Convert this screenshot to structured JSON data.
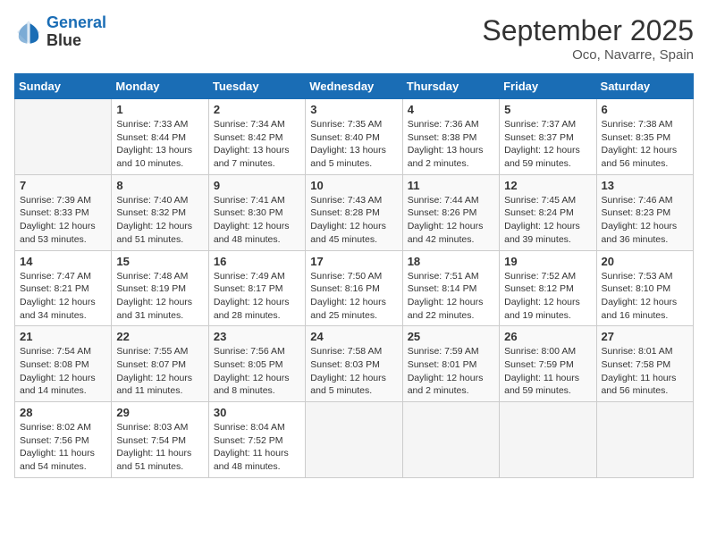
{
  "header": {
    "logo_line1": "General",
    "logo_line2": "Blue",
    "month": "September 2025",
    "location": "Oco, Navarre, Spain"
  },
  "days_of_week": [
    "Sunday",
    "Monday",
    "Tuesday",
    "Wednesday",
    "Thursday",
    "Friday",
    "Saturday"
  ],
  "weeks": [
    [
      {
        "day": "",
        "sunrise": "",
        "sunset": "",
        "daylight": ""
      },
      {
        "day": "1",
        "sunrise": "Sunrise: 7:33 AM",
        "sunset": "Sunset: 8:44 PM",
        "daylight": "Daylight: 13 hours and 10 minutes."
      },
      {
        "day": "2",
        "sunrise": "Sunrise: 7:34 AM",
        "sunset": "Sunset: 8:42 PM",
        "daylight": "Daylight: 13 hours and 7 minutes."
      },
      {
        "day": "3",
        "sunrise": "Sunrise: 7:35 AM",
        "sunset": "Sunset: 8:40 PM",
        "daylight": "Daylight: 13 hours and 5 minutes."
      },
      {
        "day": "4",
        "sunrise": "Sunrise: 7:36 AM",
        "sunset": "Sunset: 8:38 PM",
        "daylight": "Daylight: 13 hours and 2 minutes."
      },
      {
        "day": "5",
        "sunrise": "Sunrise: 7:37 AM",
        "sunset": "Sunset: 8:37 PM",
        "daylight": "Daylight: 12 hours and 59 minutes."
      },
      {
        "day": "6",
        "sunrise": "Sunrise: 7:38 AM",
        "sunset": "Sunset: 8:35 PM",
        "daylight": "Daylight: 12 hours and 56 minutes."
      }
    ],
    [
      {
        "day": "7",
        "sunrise": "Sunrise: 7:39 AM",
        "sunset": "Sunset: 8:33 PM",
        "daylight": "Daylight: 12 hours and 53 minutes."
      },
      {
        "day": "8",
        "sunrise": "Sunrise: 7:40 AM",
        "sunset": "Sunset: 8:32 PM",
        "daylight": "Daylight: 12 hours and 51 minutes."
      },
      {
        "day": "9",
        "sunrise": "Sunrise: 7:41 AM",
        "sunset": "Sunset: 8:30 PM",
        "daylight": "Daylight: 12 hours and 48 minutes."
      },
      {
        "day": "10",
        "sunrise": "Sunrise: 7:43 AM",
        "sunset": "Sunset: 8:28 PM",
        "daylight": "Daylight: 12 hours and 45 minutes."
      },
      {
        "day": "11",
        "sunrise": "Sunrise: 7:44 AM",
        "sunset": "Sunset: 8:26 PM",
        "daylight": "Daylight: 12 hours and 42 minutes."
      },
      {
        "day": "12",
        "sunrise": "Sunrise: 7:45 AM",
        "sunset": "Sunset: 8:24 PM",
        "daylight": "Daylight: 12 hours and 39 minutes."
      },
      {
        "day": "13",
        "sunrise": "Sunrise: 7:46 AM",
        "sunset": "Sunset: 8:23 PM",
        "daylight": "Daylight: 12 hours and 36 minutes."
      }
    ],
    [
      {
        "day": "14",
        "sunrise": "Sunrise: 7:47 AM",
        "sunset": "Sunset: 8:21 PM",
        "daylight": "Daylight: 12 hours and 34 minutes."
      },
      {
        "day": "15",
        "sunrise": "Sunrise: 7:48 AM",
        "sunset": "Sunset: 8:19 PM",
        "daylight": "Daylight: 12 hours and 31 minutes."
      },
      {
        "day": "16",
        "sunrise": "Sunrise: 7:49 AM",
        "sunset": "Sunset: 8:17 PM",
        "daylight": "Daylight: 12 hours and 28 minutes."
      },
      {
        "day": "17",
        "sunrise": "Sunrise: 7:50 AM",
        "sunset": "Sunset: 8:16 PM",
        "daylight": "Daylight: 12 hours and 25 minutes."
      },
      {
        "day": "18",
        "sunrise": "Sunrise: 7:51 AM",
        "sunset": "Sunset: 8:14 PM",
        "daylight": "Daylight: 12 hours and 22 minutes."
      },
      {
        "day": "19",
        "sunrise": "Sunrise: 7:52 AM",
        "sunset": "Sunset: 8:12 PM",
        "daylight": "Daylight: 12 hours and 19 minutes."
      },
      {
        "day": "20",
        "sunrise": "Sunrise: 7:53 AM",
        "sunset": "Sunset: 8:10 PM",
        "daylight": "Daylight: 12 hours and 16 minutes."
      }
    ],
    [
      {
        "day": "21",
        "sunrise": "Sunrise: 7:54 AM",
        "sunset": "Sunset: 8:08 PM",
        "daylight": "Daylight: 12 hours and 14 minutes."
      },
      {
        "day": "22",
        "sunrise": "Sunrise: 7:55 AM",
        "sunset": "Sunset: 8:07 PM",
        "daylight": "Daylight: 12 hours and 11 minutes."
      },
      {
        "day": "23",
        "sunrise": "Sunrise: 7:56 AM",
        "sunset": "Sunset: 8:05 PM",
        "daylight": "Daylight: 12 hours and 8 minutes."
      },
      {
        "day": "24",
        "sunrise": "Sunrise: 7:58 AM",
        "sunset": "Sunset: 8:03 PM",
        "daylight": "Daylight: 12 hours and 5 minutes."
      },
      {
        "day": "25",
        "sunrise": "Sunrise: 7:59 AM",
        "sunset": "Sunset: 8:01 PM",
        "daylight": "Daylight: 12 hours and 2 minutes."
      },
      {
        "day": "26",
        "sunrise": "Sunrise: 8:00 AM",
        "sunset": "Sunset: 7:59 PM",
        "daylight": "Daylight: 11 hours and 59 minutes."
      },
      {
        "day": "27",
        "sunrise": "Sunrise: 8:01 AM",
        "sunset": "Sunset: 7:58 PM",
        "daylight": "Daylight: 11 hours and 56 minutes."
      }
    ],
    [
      {
        "day": "28",
        "sunrise": "Sunrise: 8:02 AM",
        "sunset": "Sunset: 7:56 PM",
        "daylight": "Daylight: 11 hours and 54 minutes."
      },
      {
        "day": "29",
        "sunrise": "Sunrise: 8:03 AM",
        "sunset": "Sunset: 7:54 PM",
        "daylight": "Daylight: 11 hours and 51 minutes."
      },
      {
        "day": "30",
        "sunrise": "Sunrise: 8:04 AM",
        "sunset": "Sunset: 7:52 PM",
        "daylight": "Daylight: 11 hours and 48 minutes."
      },
      {
        "day": "",
        "sunrise": "",
        "sunset": "",
        "daylight": ""
      },
      {
        "day": "",
        "sunrise": "",
        "sunset": "",
        "daylight": ""
      },
      {
        "day": "",
        "sunrise": "",
        "sunset": "",
        "daylight": ""
      },
      {
        "day": "",
        "sunrise": "",
        "sunset": "",
        "daylight": ""
      }
    ]
  ]
}
